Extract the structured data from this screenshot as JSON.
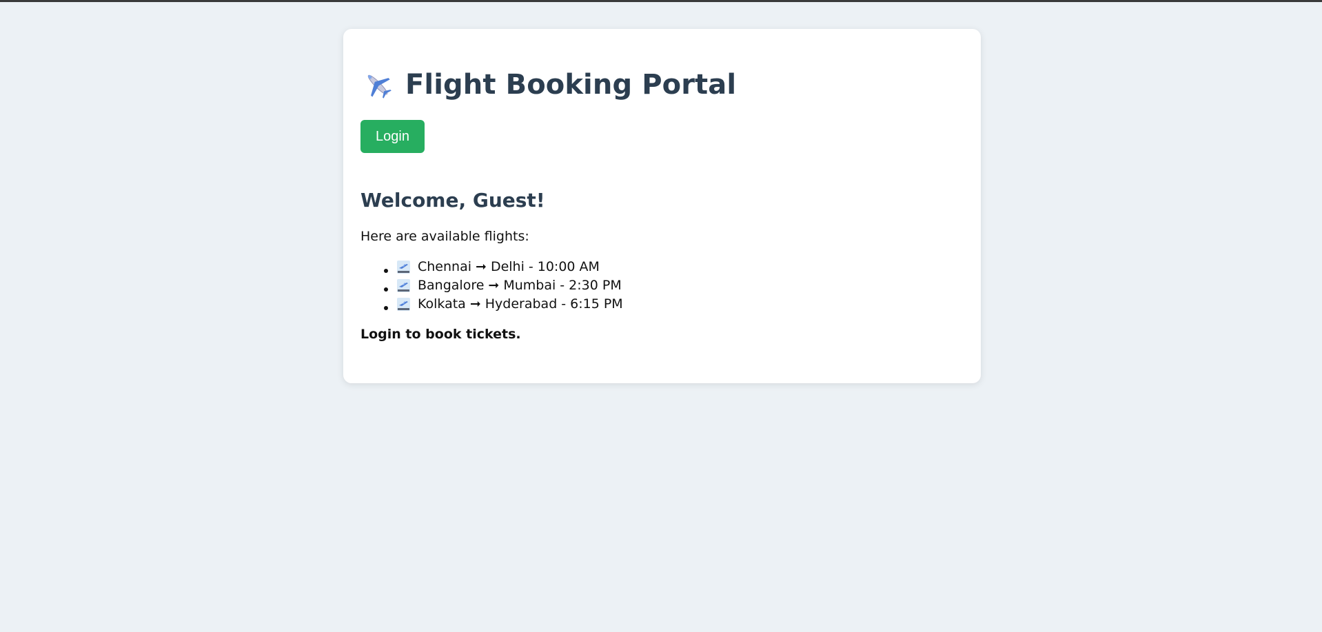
{
  "header": {
    "title": "Flight Booking Portal",
    "icon": "airplane-icon"
  },
  "auth": {
    "login_label": "Login"
  },
  "main": {
    "welcome": "Welcome, Guest!",
    "intro": "Here are available flights:",
    "flights": [
      {
        "from": "Chennai",
        "arrow": "➞",
        "to": "Delhi",
        "time": "- 10:00 AM",
        "icon": "departure-icon"
      },
      {
        "from": "Bangalore",
        "arrow": "➞",
        "to": "Mumbai",
        "time": "- 2:30 PM",
        "icon": "departure-icon"
      },
      {
        "from": "Kolkata",
        "arrow": "➞",
        "to": "Hyderabad",
        "time": "- 6:15 PM",
        "icon": "departure-icon"
      }
    ],
    "cta": "Login to book tickets."
  },
  "colors": {
    "page_bg": "#ecf1f5",
    "card_bg": "#ffffff",
    "heading": "#2c3e50",
    "login_button": "#27ae60"
  }
}
